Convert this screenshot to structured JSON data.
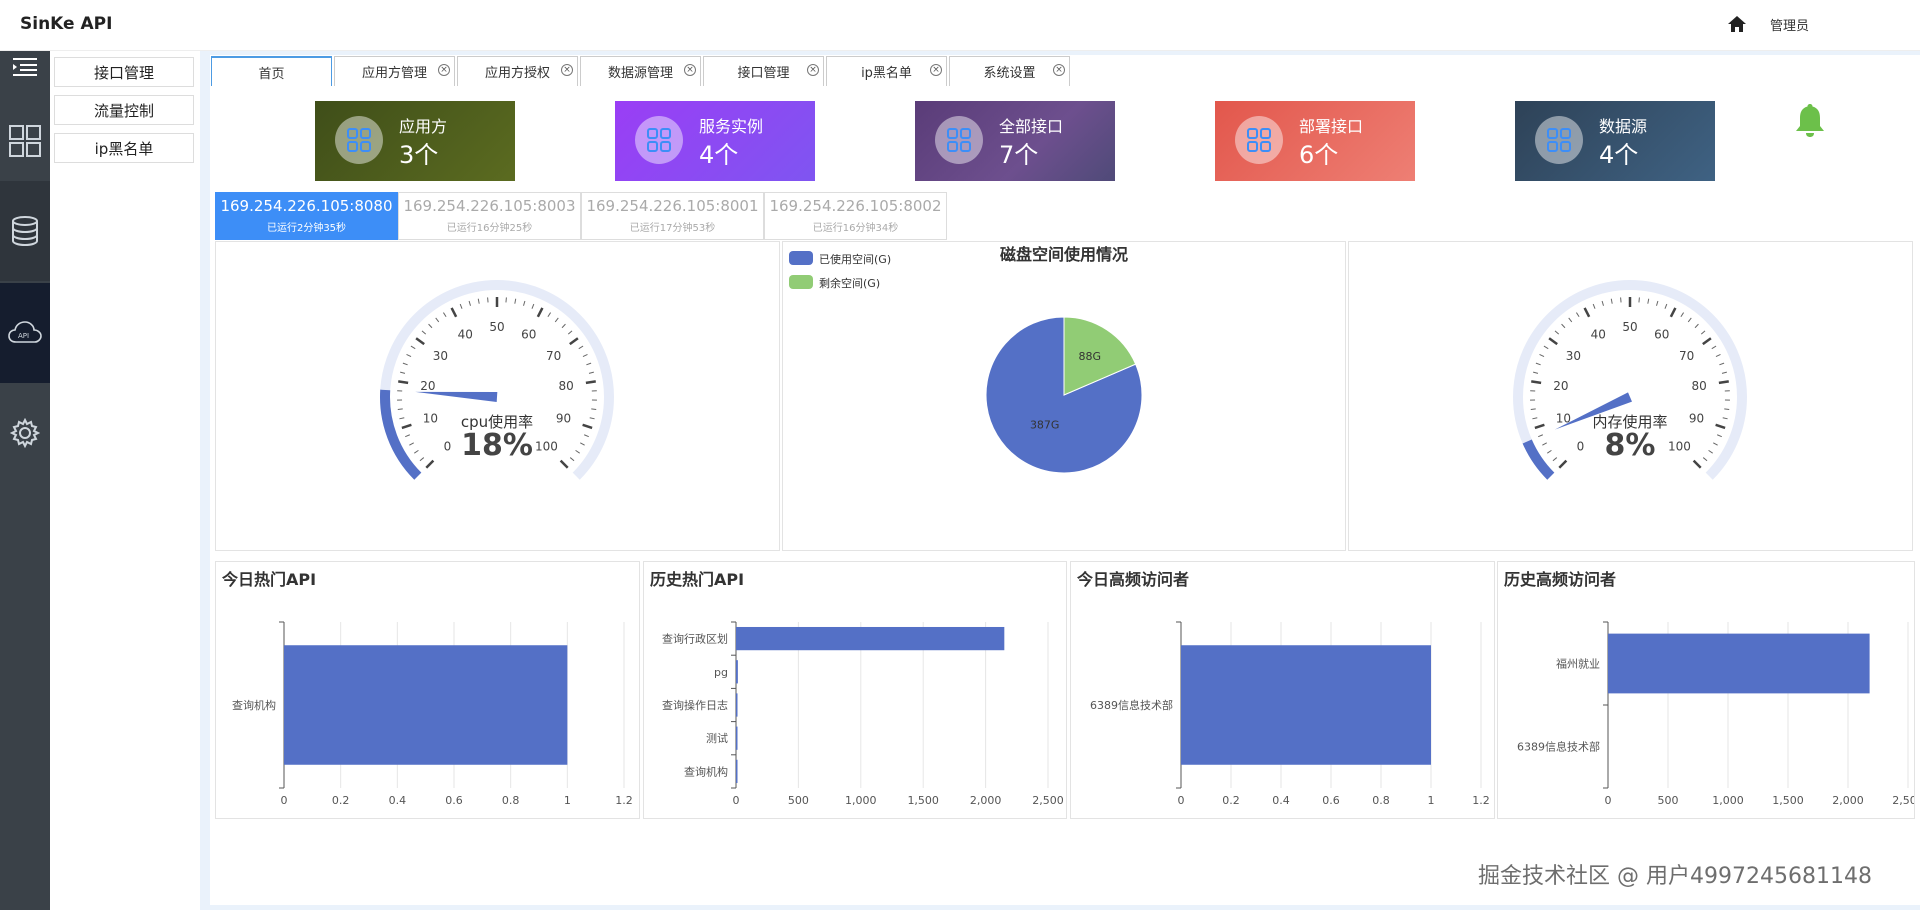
{
  "app_title": "SinKe API",
  "header": {
    "user": "管理员",
    "home_icon": "home-icon"
  },
  "sidebar_icons": [
    "menu-toggle-icon",
    "dashboard-grid-icon",
    "database-icon",
    "api-cloud-icon",
    "gear-icon"
  ],
  "submenu": [
    "接口管理",
    "流量控制",
    "ip黑名单"
  ],
  "tabs": [
    {
      "label": "首页",
      "closable": false
    },
    {
      "label": "应用方管理",
      "closable": true
    },
    {
      "label": "应用方授权",
      "closable": true
    },
    {
      "label": "数据源管理",
      "closable": true
    },
    {
      "label": "接口管理",
      "closable": true
    },
    {
      "label": "ip黑名单",
      "closable": true
    },
    {
      "label": "系统设置",
      "closable": true
    }
  ],
  "tab_close_glyph": "×",
  "cards": [
    {
      "label": "应用方",
      "count": "3个",
      "color": "#4b5a1a"
    },
    {
      "label": "服务实例",
      "count": "4个",
      "color": "#8a4af3"
    },
    {
      "label": "全部接口",
      "count": "7个",
      "color": "#6a4a86"
    },
    {
      "label": "部署接口",
      "count": "6个",
      "color": "#e86a5e"
    },
    {
      "label": "数据源",
      "count": "4个",
      "color": "#36506a"
    }
  ],
  "servers": [
    {
      "ip": "169.254.226.105:8080",
      "uptime": "已运行2分钟35秒",
      "active": true
    },
    {
      "ip": "169.254.226.105:8003",
      "uptime": "已运行16分钟25秒",
      "active": false
    },
    {
      "ip": "169.254.226.105:8001",
      "uptime": "已运行17分钟53秒",
      "active": false
    },
    {
      "ip": "169.254.226.105:8002",
      "uptime": "已运行16分钟34秒",
      "active": false
    }
  ],
  "gauges": {
    "cpu": {
      "label": "cpu使用率",
      "value": 18,
      "display": "18%",
      "min": 0,
      "max": 100,
      "ticks": [
        "0",
        "10",
        "20",
        "30",
        "40",
        "50",
        "60",
        "70",
        "80",
        "90",
        "100"
      ]
    },
    "mem": {
      "label": "内存使用率",
      "value": 8,
      "display": "8%",
      "min": 0,
      "max": 100,
      "ticks": [
        "0",
        "10",
        "20",
        "30",
        "40",
        "50",
        "60",
        "70",
        "80",
        "90",
        "100"
      ]
    }
  },
  "colors": {
    "accent": "#5470c6",
    "green": "#91cc75",
    "gauge_track": "#e6ebf8"
  },
  "chart_data": [
    {
      "type": "pie",
      "title": "磁盘空间使用情况",
      "slices": [
        {
          "name": "已使用空间(G)",
          "value": 387,
          "label": "387G"
        },
        {
          "name": "剩余空间(G)",
          "value": 88,
          "label": "88G"
        }
      ]
    },
    {
      "type": "bar",
      "orientation": "horizontal",
      "title": "今日热门API",
      "categories": [
        "查询机构"
      ],
      "values": [
        1
      ],
      "xlim": [
        0,
        1.2
      ],
      "xticks": [
        "0",
        "0.2",
        "0.4",
        "0.6",
        "0.8",
        "1",
        "1.2"
      ]
    },
    {
      "type": "bar",
      "orientation": "horizontal",
      "title": "历史热门API",
      "categories": [
        "查询行政区划",
        "pg",
        "查询操作日志",
        "测试",
        "查询机构"
      ],
      "values": [
        2150,
        15,
        8,
        3,
        2
      ],
      "xlim": [
        0,
        2500
      ],
      "xticks": [
        "0",
        "500",
        "1,000",
        "1,500",
        "2,000",
        "2,500"
      ]
    },
    {
      "type": "bar",
      "orientation": "horizontal",
      "title": "今日高频访问者",
      "categories": [
        "6389信息技术部"
      ],
      "values": [
        1
      ],
      "xlim": [
        0,
        1.2
      ],
      "xticks": [
        "0",
        "0.2",
        "0.4",
        "0.6",
        "0.8",
        "1",
        "1.2"
      ]
    },
    {
      "type": "bar",
      "orientation": "horizontal",
      "title": "历史高频访问者",
      "categories": [
        "福州就业",
        "6389信息技术部"
      ],
      "values": [
        2180,
        0
      ],
      "xlim": [
        0,
        2500
      ],
      "xticks": [
        "0",
        "500",
        "1,000",
        "1,500",
        "2,000",
        "2,500"
      ]
    }
  ],
  "watermark": "掘金技术社区 @ 用户4997245681148"
}
